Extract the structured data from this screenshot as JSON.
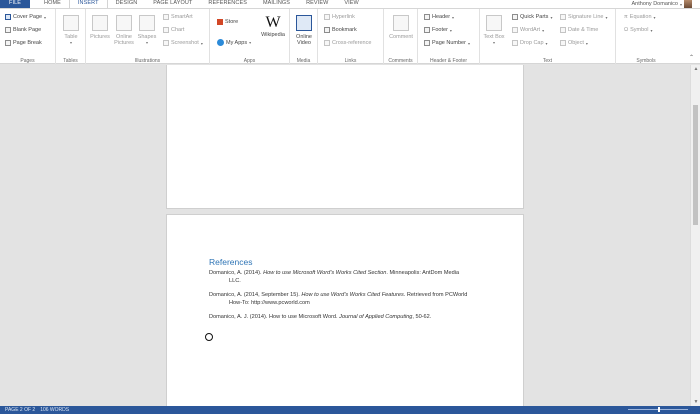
{
  "tabs": [
    {
      "label": "FILE"
    },
    {
      "label": "HOME"
    },
    {
      "label": "INSERT"
    },
    {
      "label": "DESIGN"
    },
    {
      "label": "PAGE LAYOUT"
    },
    {
      "label": "REFERENCES"
    },
    {
      "label": "MAILINGS"
    },
    {
      "label": "REVIEW"
    },
    {
      "label": "VIEW"
    }
  ],
  "active_tab": "INSERT",
  "user": {
    "name": "Anthony Domanico"
  },
  "ribbon": {
    "pages": {
      "label": "Pages",
      "cover_page": "Cover Page",
      "blank_page": "Blank Page",
      "page_break": "Page Break"
    },
    "tables": {
      "label": "Tables",
      "table": "Table"
    },
    "illustrations": {
      "label": "Illustrations",
      "pictures": "Pictures",
      "online_pictures": "Online Pictures",
      "shapes": "Shapes",
      "smartart": "SmartArt",
      "chart": "Chart",
      "screenshot": "Screenshot"
    },
    "apps": {
      "label": "Apps",
      "store": "Store",
      "my_apps": "My Apps",
      "wikipedia": "Wikipedia",
      "wiki_glyph": "W"
    },
    "media": {
      "label": "Media",
      "online_video": "Online Video"
    },
    "links": {
      "label": "Links",
      "hyperlink": "Hyperlink",
      "bookmark": "Bookmark",
      "cross_reference": "Cross-reference"
    },
    "comments": {
      "label": "Comments",
      "comment": "Comment"
    },
    "header_footer": {
      "label": "Header & Footer",
      "header": "Header",
      "footer": "Footer",
      "page_number": "Page Number"
    },
    "text": {
      "label": "Text",
      "text_box": "Text Box",
      "quick_parts": "Quick Parts",
      "wordart": "WordArt",
      "drop_cap": "Drop Cap",
      "signature_line": "Signature Line",
      "date_time": "Date & Time",
      "object": "Object"
    },
    "symbols": {
      "label": "Symbols",
      "equation": "Equation",
      "symbol": "Symbol"
    }
  },
  "document": {
    "heading": "References",
    "refs": [
      {
        "plain1": "Domanico, A. (2014). ",
        "italic": "How to use Microsoft Word's Works Cited Section",
        "plain2": ". Minneapolis: AntDom Media",
        "cont": "LLC."
      },
      {
        "plain1": "Domanico, A. (2014, September 15). ",
        "italic": "How to use Word's Works Cited Features",
        "plain2": ". Retrieved from PCWorld",
        "cont": "How-To: http://www.pcworld.com"
      },
      {
        "plain1": "Domanico, A. J. (2014). How to use Microsoft Word. ",
        "italic": "Journal of Applied Computing",
        "plain2": ", 50-62.",
        "cont": ""
      }
    ]
  },
  "status": {
    "page": "PAGE 2 OF 2",
    "words": "106 WORDS"
  }
}
